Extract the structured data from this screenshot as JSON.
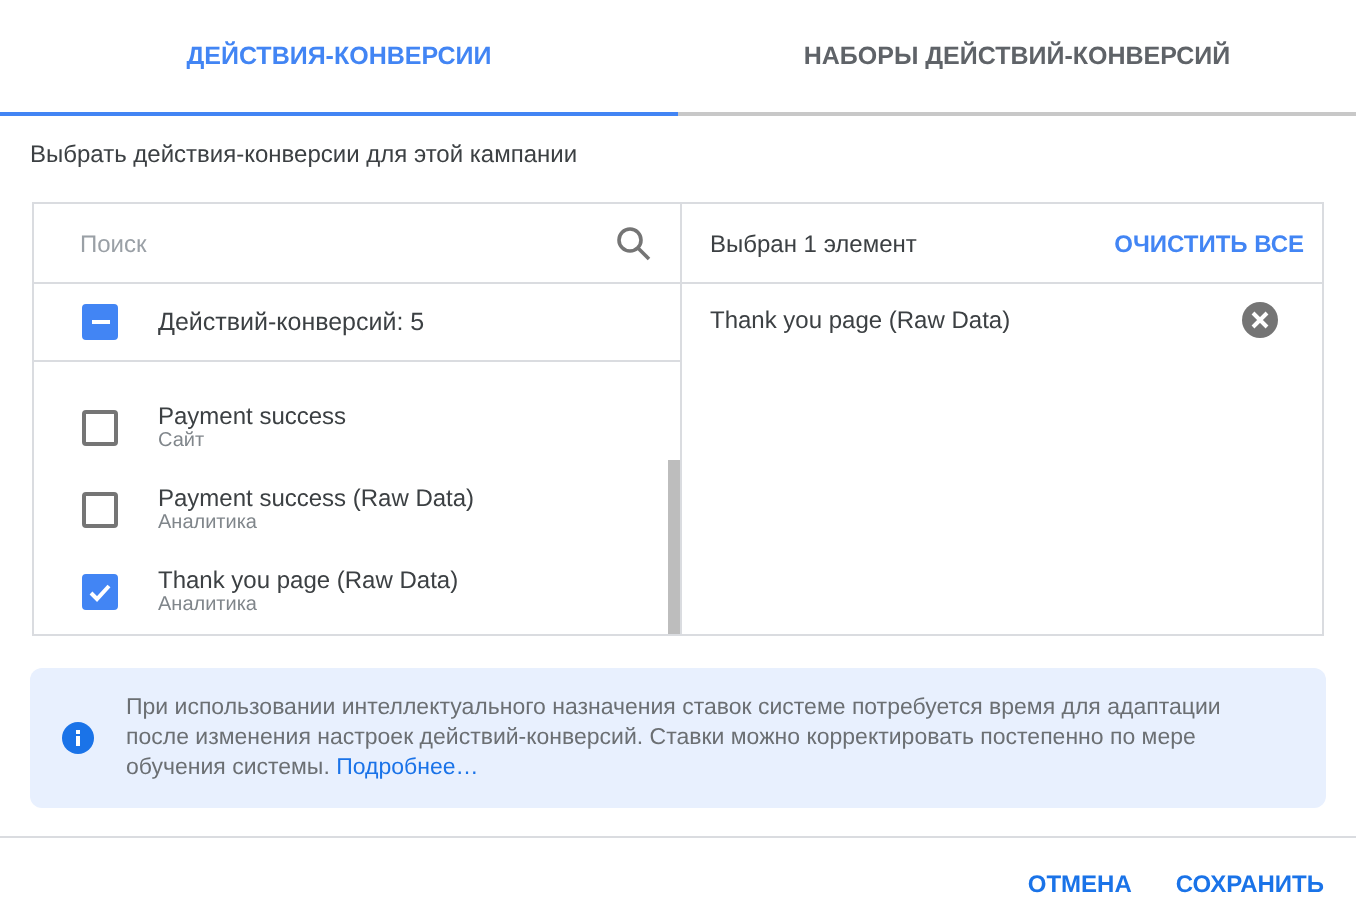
{
  "tabs": [
    {
      "label": "ДЕЙСТВИЯ-КОНВЕРСИИ",
      "selected": true
    },
    {
      "label": "НАБОРЫ ДЕЙСТВИЙ-КОНВЕРСИЙ",
      "selected": false
    }
  ],
  "subtitle": "Выбрать действия-конверсии для этой кампании",
  "search": {
    "placeholder": "Поиск"
  },
  "group": {
    "label": "Действий-конверсий: 5",
    "indeterminate": true
  },
  "items": [
    {
      "name": "Payment success",
      "source": "Сайт",
      "checked": false
    },
    {
      "name": "Payment success (Raw Data)",
      "source": "Аналитика",
      "checked": false
    },
    {
      "name": "Thank you page (Raw Data)",
      "source": "Аналитика",
      "checked": true
    }
  ],
  "selection": {
    "summary": "Выбран 1 элемент",
    "clear_label": "ОЧИСТИТЬ ВСЕ",
    "items": [
      "Thank you page (Raw Data)"
    ]
  },
  "info": {
    "text": "При использовании интеллектуального назначения ставок системе потребуется время для адаптации после изменения настроек действий-конверсий. Ставки можно корректировать постепенно по мере обучения системы.",
    "link": "Подробнее…"
  },
  "buttons": [
    "ОТМЕНА",
    "СОХРАНИТЬ"
  ]
}
